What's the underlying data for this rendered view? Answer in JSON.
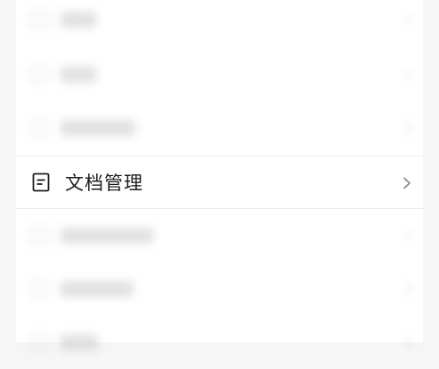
{
  "menu": {
    "items": [
      {
        "state": "blurred"
      },
      {
        "state": "blurred"
      },
      {
        "state": "blurred"
      },
      {
        "label": "文档管理",
        "icon": "document-icon",
        "state": "focused",
        "chevron": "chevron-right-icon"
      },
      {
        "state": "blurred"
      },
      {
        "state": "blurred"
      },
      {
        "state": "blurred"
      }
    ]
  },
  "colors": {
    "background": "#f6f6f6",
    "panel": "#ffffff",
    "text": "#1d1d1d",
    "chevron": "#8a8a8a"
  }
}
